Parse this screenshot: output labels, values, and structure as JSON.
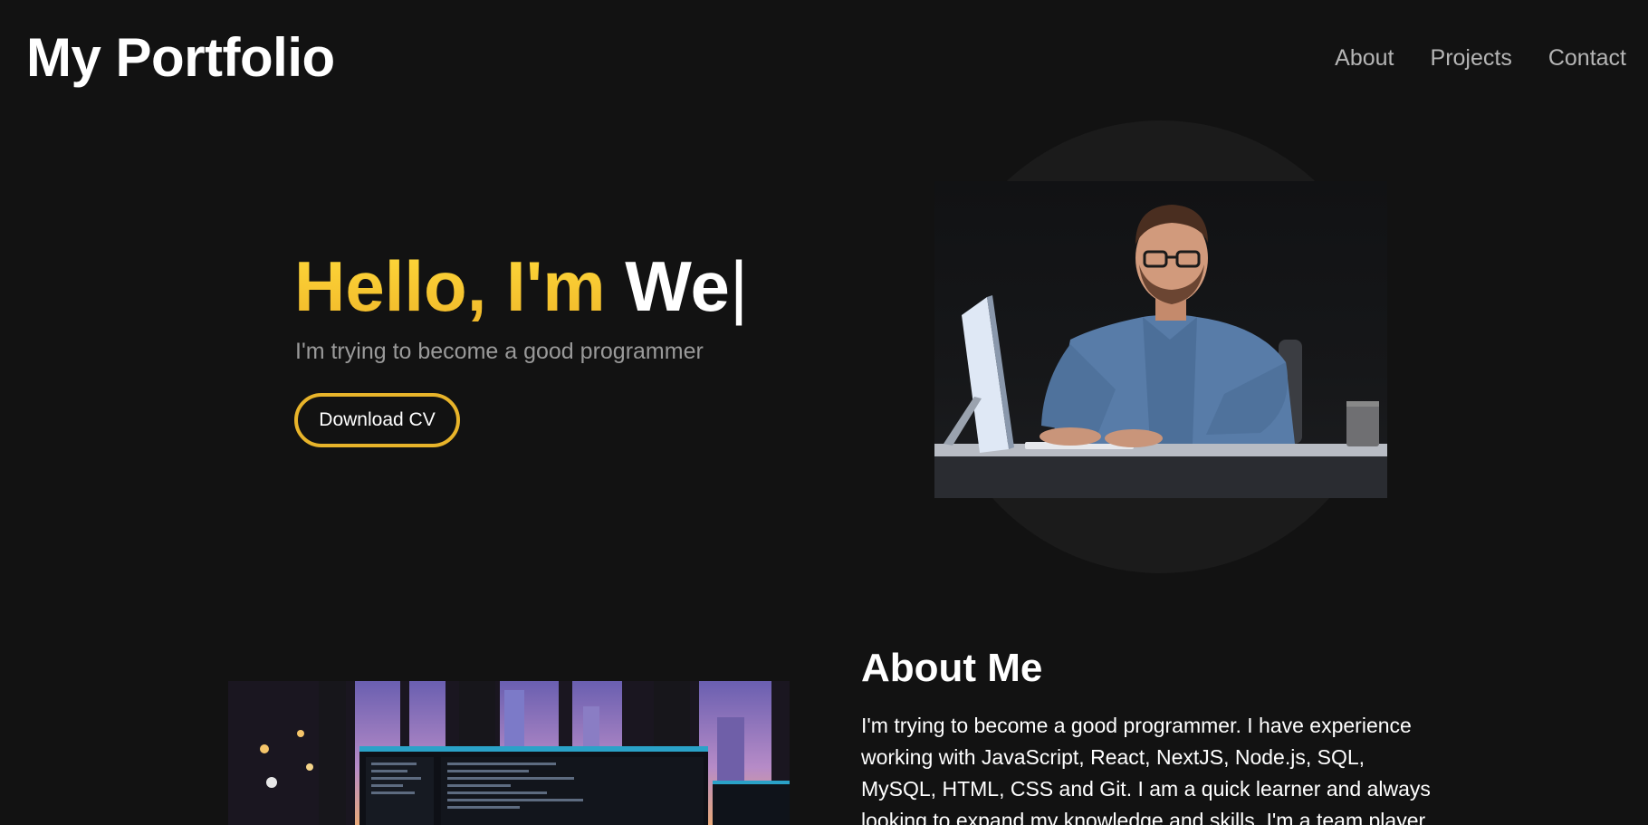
{
  "header": {
    "logo": "My Portfolio",
    "nav": [
      "About",
      "Projects",
      "Contact"
    ]
  },
  "hero": {
    "greeting": "Hello, I'm ",
    "typed": "We",
    "cursor": "|",
    "subtitle": "I'm trying to become a good programmer",
    "cv_button": "Download CV"
  },
  "about": {
    "title": "About Me",
    "text": "I'm trying to become a good programmer. I have experience working with JavaScript, React, NextJS, Node.js, SQL, MySQL, HTML, CSS and Git. I am a quick learner and always looking to expand my knowledge and skills. I'm a team player"
  },
  "colors": {
    "background": "#121212",
    "accent_yellow": "#f5c533",
    "nav_text": "#b5b5b5",
    "subtitle_text": "#9a9a9a"
  }
}
